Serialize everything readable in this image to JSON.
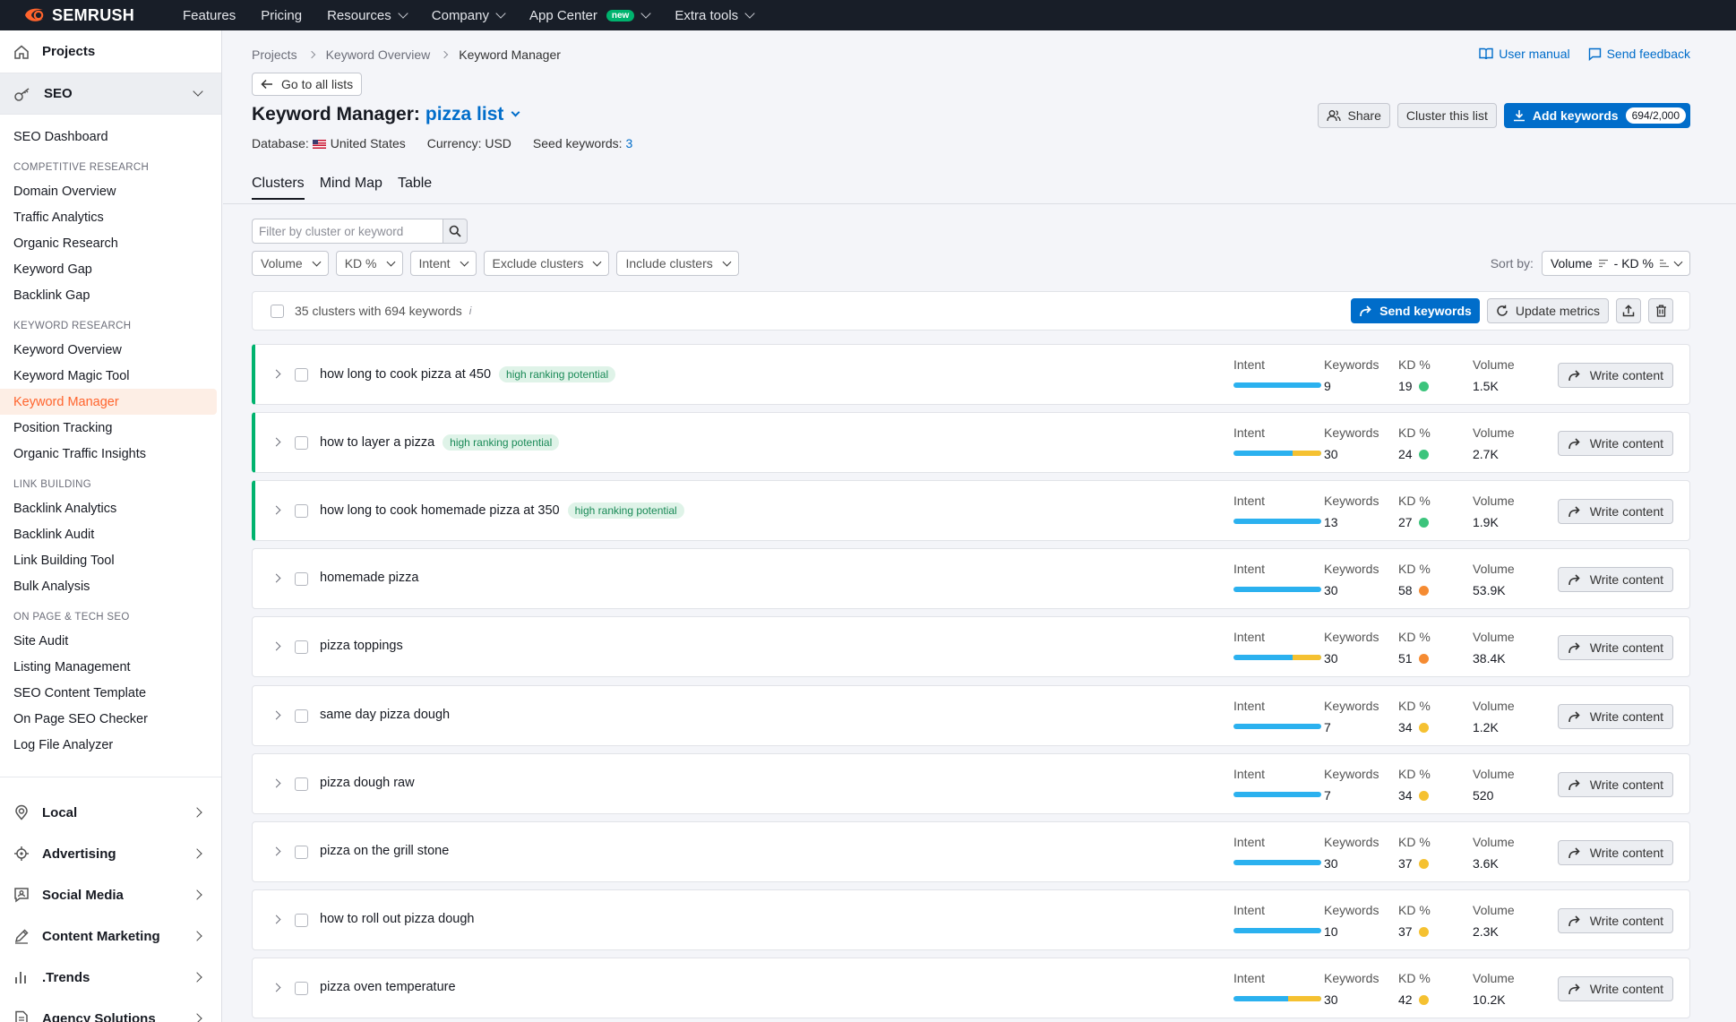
{
  "topnav": {
    "brand": "SEMRUSH",
    "items": [
      {
        "label": "Features",
        "dropdown": false
      },
      {
        "label": "Pricing",
        "dropdown": false
      },
      {
        "label": "Resources",
        "dropdown": true
      },
      {
        "label": "Company",
        "dropdown": true
      },
      {
        "label": "App Center",
        "dropdown": true,
        "badge": "new"
      },
      {
        "label": "Extra tools",
        "dropdown": true
      }
    ]
  },
  "sidebar": {
    "projects": "Projects",
    "seo": "SEO",
    "dashboard": "SEO Dashboard",
    "sections": [
      {
        "title": "COMPETITIVE RESEARCH",
        "items": [
          "Domain Overview",
          "Traffic Analytics",
          "Organic Research",
          "Keyword Gap",
          "Backlink Gap"
        ]
      },
      {
        "title": "KEYWORD RESEARCH",
        "items": [
          "Keyword Overview",
          "Keyword Magic Tool",
          "Keyword Manager",
          "Position Tracking",
          "Organic Traffic Insights"
        ]
      },
      {
        "title": "LINK BUILDING",
        "items": [
          "Backlink Analytics",
          "Backlink Audit",
          "Link Building Tool",
          "Bulk Analysis"
        ]
      },
      {
        "title": "ON PAGE & TECH SEO",
        "items": [
          "Site Audit",
          "Listing Management",
          "SEO Content Template",
          "On Page SEO Checker",
          "Log File Analyzer"
        ]
      }
    ],
    "active_item": "Keyword Manager",
    "groups": [
      "Local",
      "Advertising",
      "Social Media",
      "Content Marketing",
      ".Trends",
      "Agency Solutions"
    ]
  },
  "breadcrumb": [
    "Projects",
    "Keyword Overview",
    "Keyword Manager"
  ],
  "header_links": {
    "manual": "User manual",
    "feedback": "Send feedback"
  },
  "back_button": "Go to all lists",
  "title": {
    "prefix": "Keyword Manager:",
    "list_name": "pizza list"
  },
  "meta": {
    "database_label": "Database:",
    "database_value": "United States",
    "currency": "Currency: USD",
    "seed_label": "Seed keywords:",
    "seed_value": "3"
  },
  "actions": {
    "share": "Share",
    "cluster": "Cluster this list",
    "add": "Add keywords",
    "add_count": "694/2,000"
  },
  "tabs": [
    "Clusters",
    "Mind Map",
    "Table"
  ],
  "active_tab": "Clusters",
  "filters": {
    "search_placeholder": "Filter by cluster or keyword",
    "dropdowns": [
      "Volume",
      "KD %",
      "Intent",
      "Exclude clusters",
      "Include clusters"
    ],
    "sort_label": "Sort by:",
    "sort_value": "Volume",
    "sort_value2": "- KD %"
  },
  "bulk": {
    "summary": "35 clusters with 694 keywords",
    "info": "i",
    "send": "Send keywords",
    "update": "Update metrics"
  },
  "columns": {
    "intent": "Intent",
    "keywords": "Keywords",
    "kd": "KD %",
    "volume": "Volume"
  },
  "write_label": "Write content",
  "colors": {
    "accent": "#006dca",
    "brand": "#ff642d",
    "hp_border": "#00b36e",
    "kd_easy": "#3cc47c",
    "kd_hard": "#f58b32",
    "kd_possible": "#f5c131",
    "intent_info": "#2bb1ef",
    "intent_commercial": "#f5c131"
  },
  "clusters": [
    {
      "name": "how long to cook pizza at 450",
      "badge": "high ranking potential",
      "keywords": "9",
      "kd": "19",
      "kd_color": "#3cc47c",
      "volume": "1.5K",
      "intent_secondary_fraction": 0
    },
    {
      "name": "how to layer a pizza",
      "badge": "high ranking potential",
      "keywords": "30",
      "kd": "24",
      "kd_color": "#3cc47c",
      "volume": "2.7K",
      "intent_secondary_fraction": 0.33
    },
    {
      "name": "how long to cook homemade pizza at 350",
      "badge": "high ranking potential",
      "keywords": "13",
      "kd": "27",
      "kd_color": "#3cc47c",
      "volume": "1.9K",
      "intent_secondary_fraction": 0
    },
    {
      "name": "homemade pizza",
      "badge": "",
      "keywords": "30",
      "kd": "58",
      "kd_color": "#f58b32",
      "volume": "53.9K",
      "intent_secondary_fraction": 0
    },
    {
      "name": "pizza toppings",
      "badge": "",
      "keywords": "30",
      "kd": "51",
      "kd_color": "#f58b32",
      "volume": "38.4K",
      "intent_secondary_fraction": 0.33
    },
    {
      "name": "same day pizza dough",
      "badge": "",
      "keywords": "7",
      "kd": "34",
      "kd_color": "#f5c131",
      "volume": "1.2K",
      "intent_secondary_fraction": 0
    },
    {
      "name": "pizza dough raw",
      "badge": "",
      "keywords": "7",
      "kd": "34",
      "kd_color": "#f5c131",
      "volume": "520",
      "intent_secondary_fraction": 0
    },
    {
      "name": "pizza on the grill stone",
      "badge": "",
      "keywords": "30",
      "kd": "37",
      "kd_color": "#f5c131",
      "volume": "3.6K",
      "intent_secondary_fraction": 0
    },
    {
      "name": "how to roll out pizza dough",
      "badge": "",
      "keywords": "10",
      "kd": "37",
      "kd_color": "#f5c131",
      "volume": "2.3K",
      "intent_secondary_fraction": 0
    },
    {
      "name": "pizza oven temperature",
      "badge": "",
      "keywords": "30",
      "kd": "42",
      "kd_color": "#f5c131",
      "volume": "10.2K",
      "intent_secondary_fraction": 0.38
    }
  ]
}
